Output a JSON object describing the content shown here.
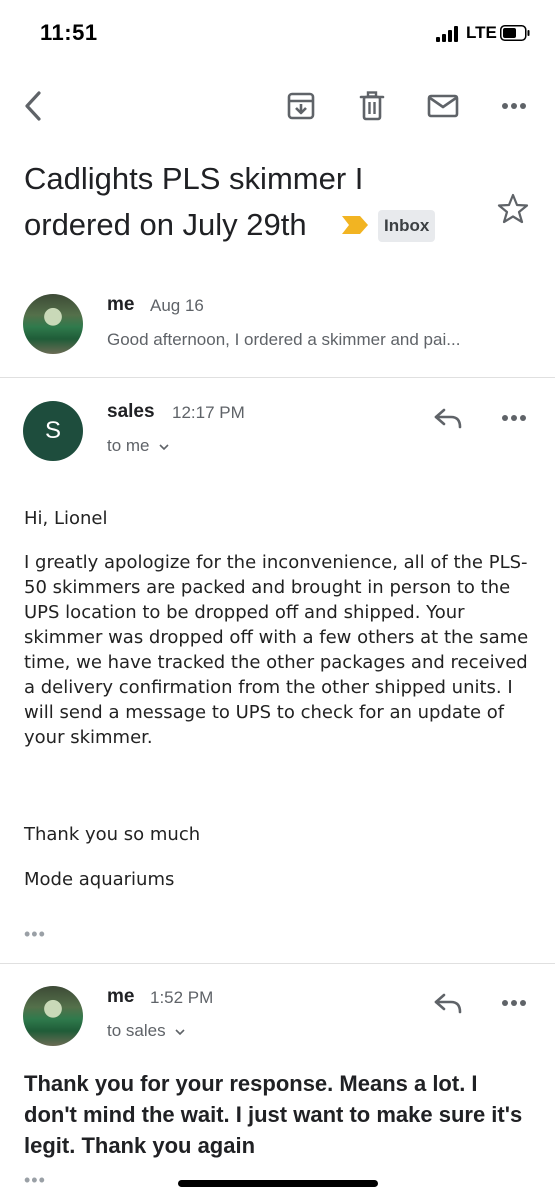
{
  "status_bar": {
    "time": "11:51",
    "network": "LTE"
  },
  "thread": {
    "subject_line1": "Cadlights PLS skimmer I",
    "subject_line2": "ordered on July 29th",
    "label": "Inbox"
  },
  "messages": [
    {
      "sender": "me",
      "date": "Aug 16",
      "snippet": "Good afternoon, I ordered a skimmer and pai..."
    },
    {
      "sender": "sales",
      "avatar_letter": "S",
      "time": "12:17 PM",
      "to": "to me",
      "greeting": "Hi, Lionel",
      "body": "I greatly apologize for the inconvenience, all of the PLS-50 skimmers are packed and brought in person to the UPS location to be dropped off and shipped. Your skimmer was dropped off with a few others at the same time, we have tracked the other packages and received a delivery confirmation from the other shipped units. I will send a message to UPS to check for an update of your skimmer.",
      "thanks": "Thank you so much",
      "signature": "Mode aquariums",
      "more": "•••"
    },
    {
      "sender": "me",
      "time": "1:52 PM",
      "to": "to sales",
      "body": "Thank you for your response. Means a lot. I don't mind the wait. I just want to make sure it's legit. Thank you again",
      "more": "•••"
    }
  ],
  "icons": {
    "back": "back-arrow-icon",
    "archive": "archive-icon",
    "delete": "trash-icon",
    "unread": "mail-icon",
    "more": "more-icon",
    "star": "star-icon",
    "reply": "reply-icon"
  },
  "colors": {
    "importance_marker": "#f2b422",
    "sales_avatar": "#1e4d3d",
    "label_bg": "#e8eaed"
  }
}
